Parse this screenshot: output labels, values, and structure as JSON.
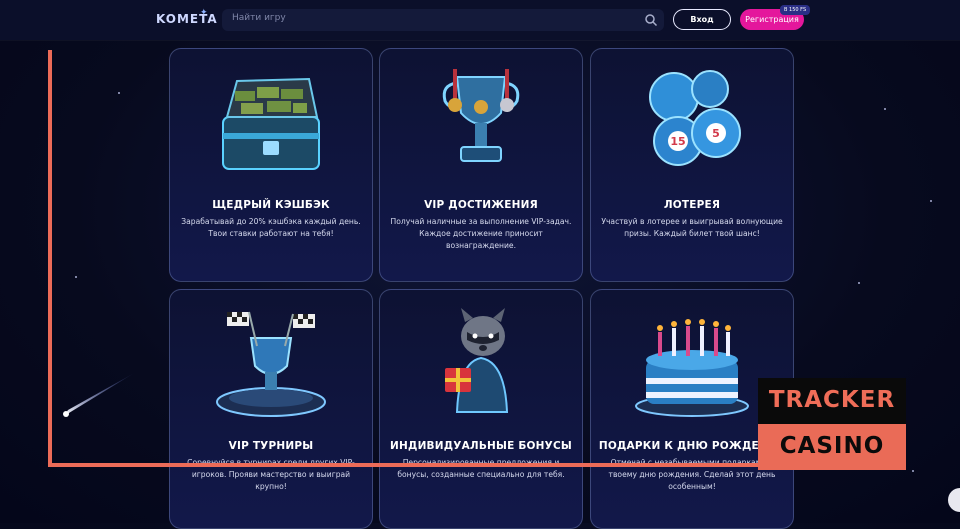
{
  "header": {
    "logo": "KOMETA",
    "search_placeholder": "Найти игру",
    "login_label": "Вход",
    "register_label": "Регистрация",
    "register_badge": "В 150 FS"
  },
  "cards": [
    {
      "title": "ЩЕДРЫЙ КЭШБЭК",
      "desc": "Зарабатывай до 20% кэшбэка каждый день. Твои ставки работают на тебя!",
      "icon": "treasure-chest"
    },
    {
      "title": "VIP ДОСТИЖЕНИЯ",
      "desc": "Получай наличные за выполнение VIP-задач. Каждое достижение приносит вознаграждение.",
      "icon": "trophy-medals"
    },
    {
      "title": "ЛОТЕРЕЯ",
      "desc": "Участвуй в лотерее и выигрывай волнующие призы. Каждый билет твой шанс!",
      "icon": "lottery-balls"
    },
    {
      "title": "VIP ТУРНИРЫ",
      "desc": "Соревнуйся в турнирах среди других VIP-игроков. Прояви мастерство и выиграй крупно!",
      "icon": "racing-trophy"
    },
    {
      "title": "ИНДИВИДУАЛЬНЫЕ БОНУСЫ",
      "desc": "Персонализированные предложения и бонусы, созданные специально для тебя.",
      "icon": "raccoon-gift"
    },
    {
      "title": "ПОДАРКИ К ДНЮ РОЖДЕНИЯ",
      "desc": "Отмечай с незабываемыми подарками к твоему дню рождения. Сделай этот день особенным!",
      "icon": "birthday-cake"
    }
  ],
  "watermark": {
    "line1": "TRACKER",
    "line2": "CASINO"
  },
  "colors": {
    "accent": "#e4179c",
    "overlay": "#ec6b58",
    "background": "#070a1e"
  }
}
